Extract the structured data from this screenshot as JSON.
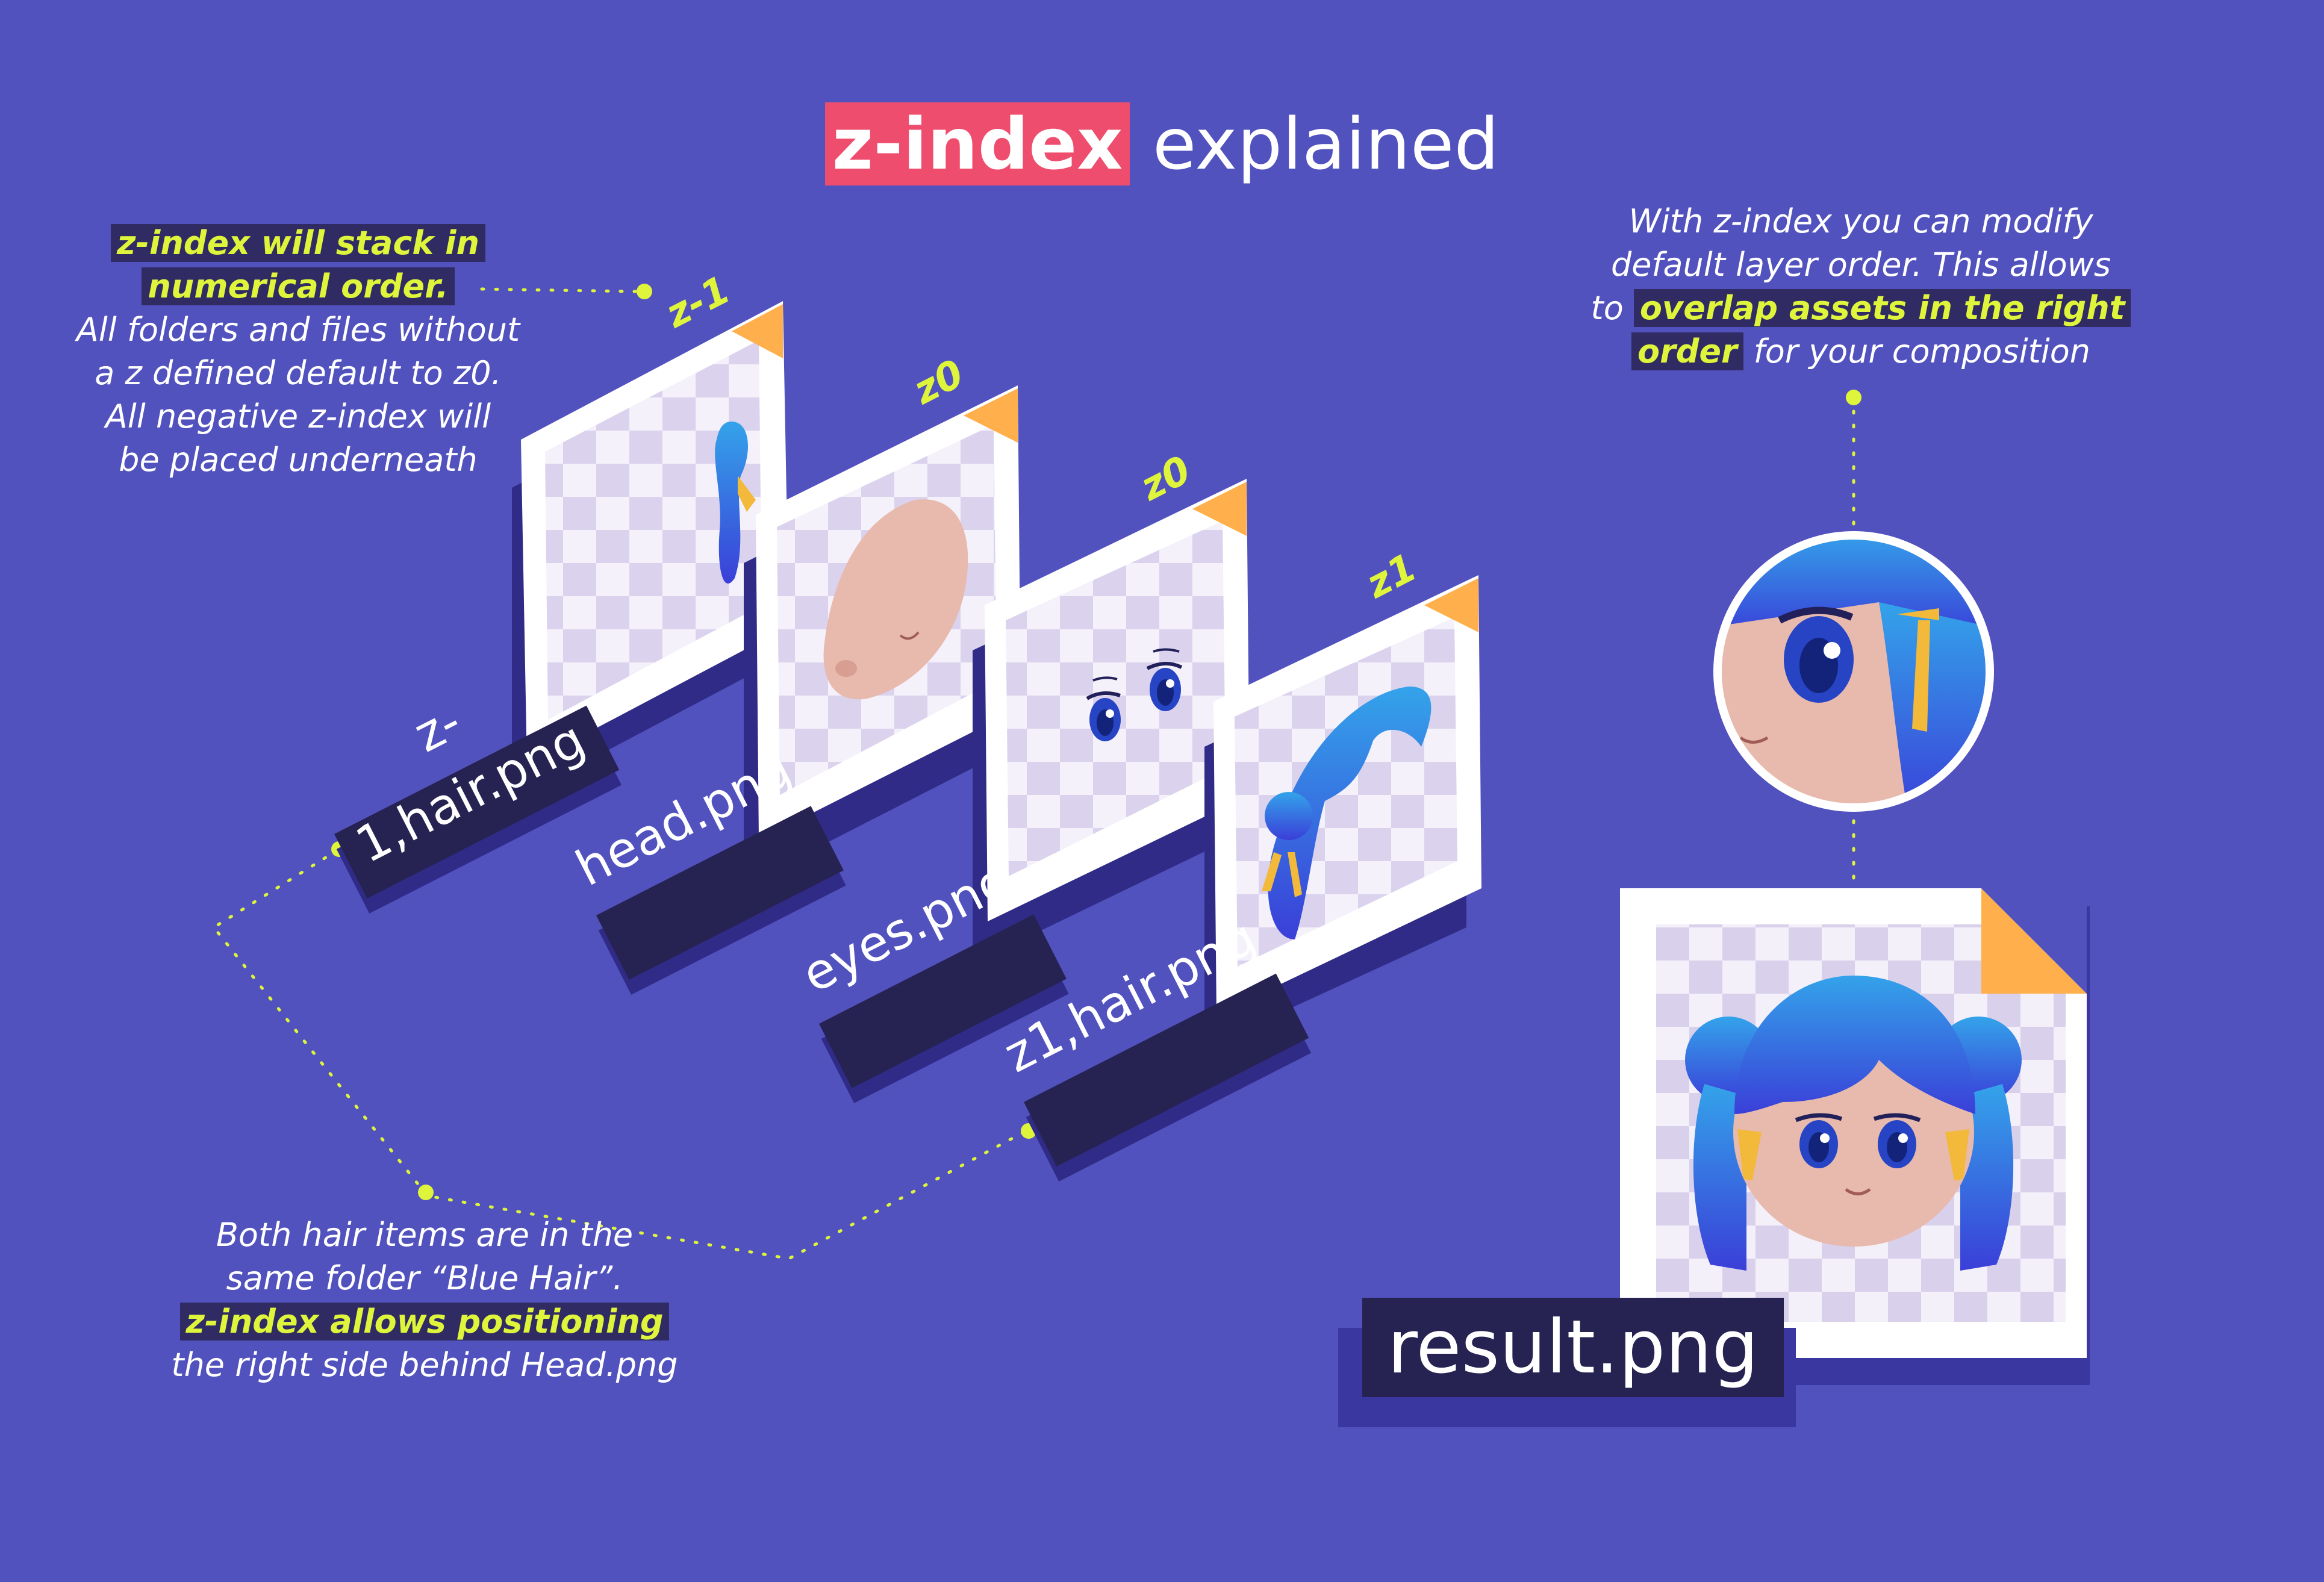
{
  "title": {
    "highlight": "z-index",
    "rest": " explained"
  },
  "notes": {
    "stack_order": {
      "highlight_lines": [
        "z-index will stack in",
        "numerical order."
      ],
      "lines": [
        "All folders and files without",
        "a z defined default to z0.",
        "All negative z-index will",
        "be placed underneath"
      ]
    },
    "modify_order": {
      "line1": "With z-index you can modify",
      "line2": "default layer order. This allows",
      "line3_prefix": "to ",
      "line3_highlight": "overlap assets in the right",
      "line4_highlight": "order",
      "line4_suffix": " for your composition"
    },
    "hair_items": {
      "lines": [
        "Both hair items are in the",
        "same folder “Blue Hair”."
      ],
      "highlight": "z-index allows positioning",
      "last": "the right side behind Head.png"
    }
  },
  "layers": [
    {
      "z_label": "z-1",
      "file": "z-1,hair.png",
      "content": "hair-back"
    },
    {
      "z_label": "z0",
      "file": "head.png",
      "content": "head"
    },
    {
      "z_label": "z0",
      "file": "eyes.png",
      "content": "eyes"
    },
    {
      "z_label": "z1",
      "file": "z1,hair.png",
      "content": "hair-front"
    }
  ],
  "result": {
    "file": "result.png"
  },
  "colors": {
    "background": "#5152be",
    "title_highlight": "#ef4d6e",
    "yellow_accent": "#dff53b",
    "label_dark": "#262352",
    "dog_ear": "#ffb04d",
    "hair_blue": "#3b6fe0",
    "skin": "#e8b9ad"
  }
}
